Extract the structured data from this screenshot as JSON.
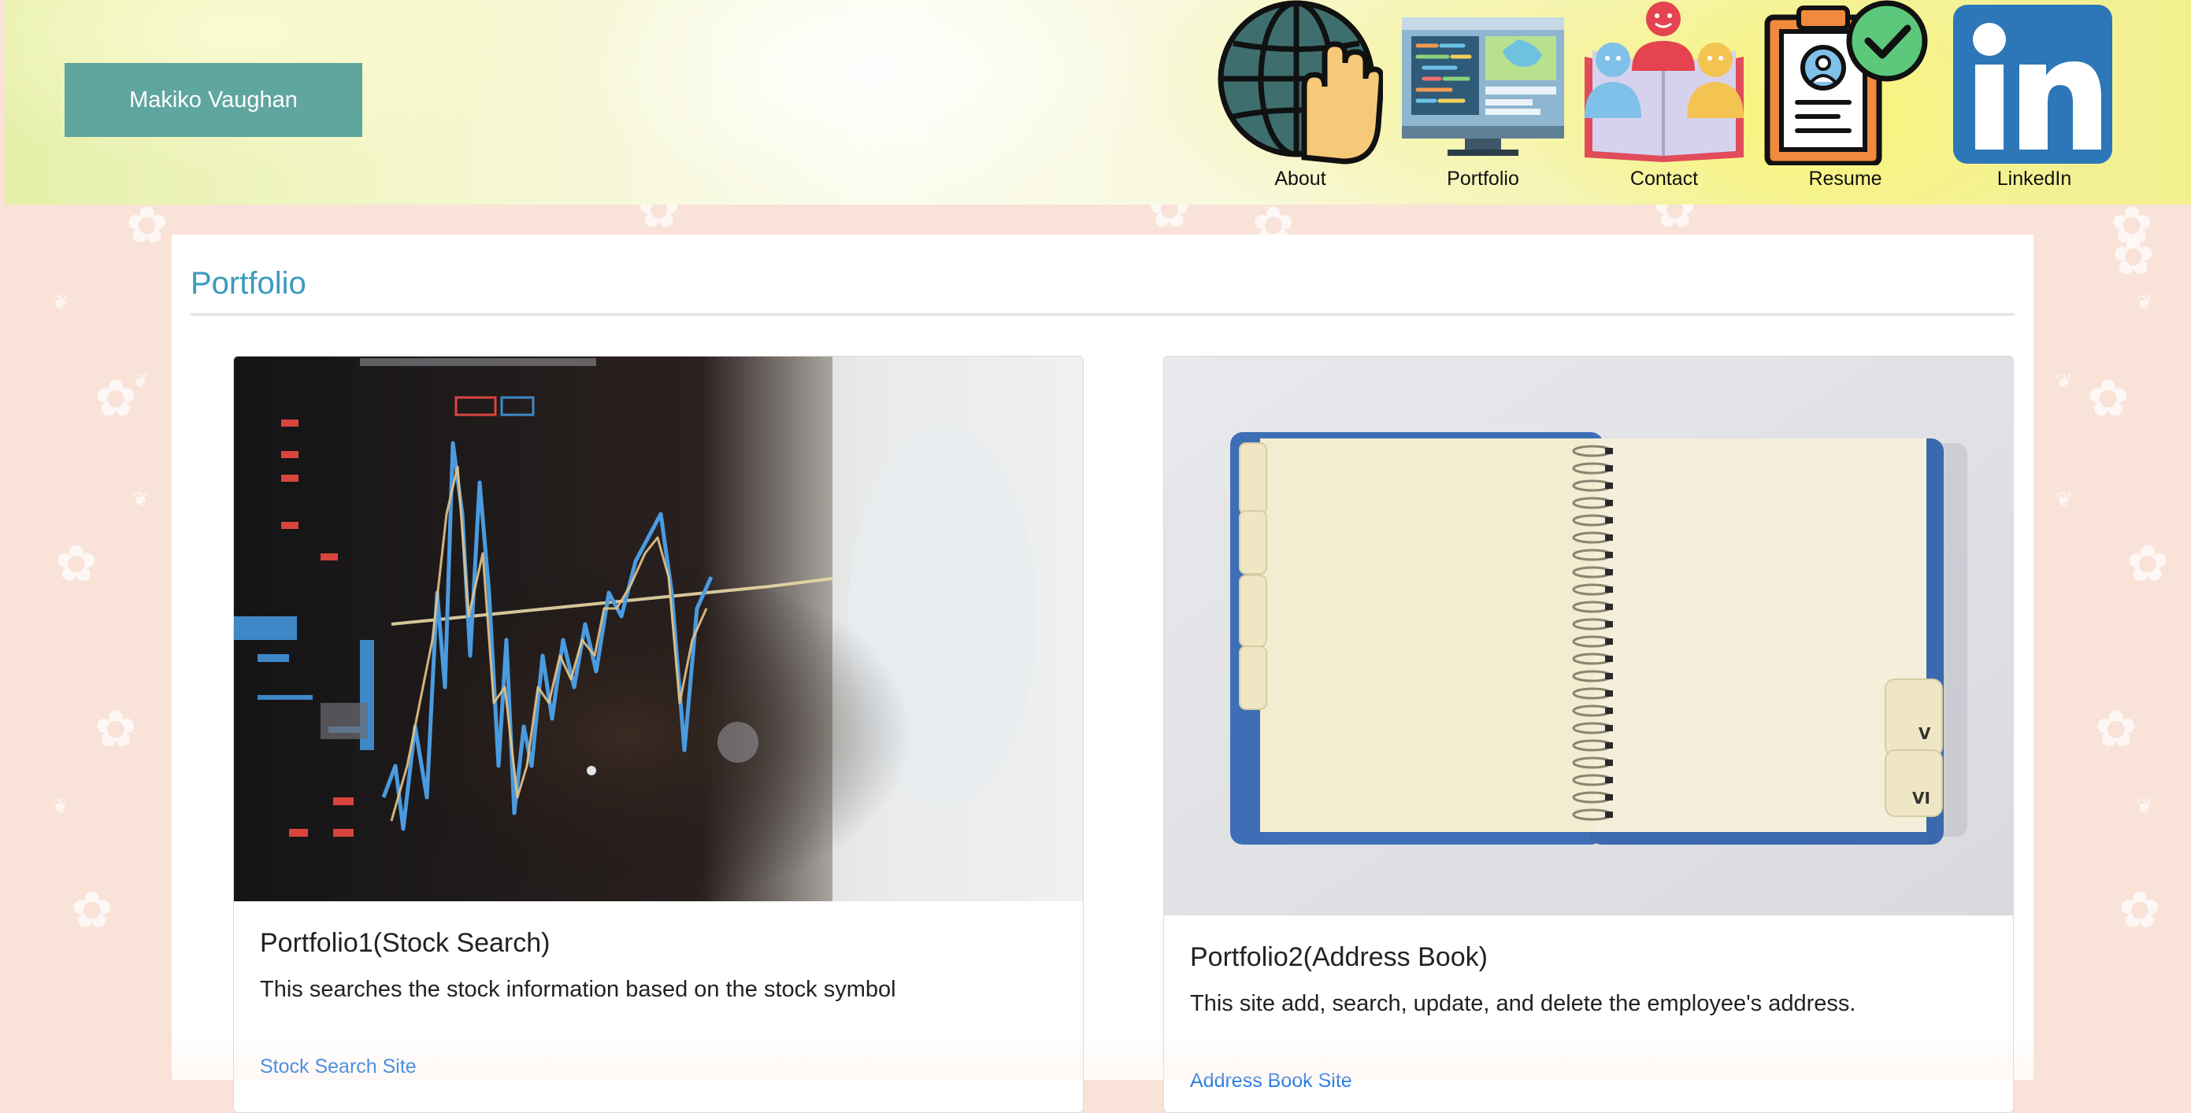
{
  "header": {
    "brand": "Makiko Vaughan",
    "nav": [
      {
        "label": "About",
        "icon": "globe-hand-icon"
      },
      {
        "label": "Portfolio",
        "icon": "monitor-code-icon"
      },
      {
        "label": "Contact",
        "icon": "people-book-icon"
      },
      {
        "label": "Resume",
        "icon": "clipboard-check-icon"
      },
      {
        "label": "LinkedIn",
        "icon": "linkedin-icon"
      }
    ]
  },
  "main": {
    "section_title": "Portfolio",
    "cards": [
      {
        "title": "Portfolio1(Stock Search)",
        "description": "This searches the stock information based on the stock symbol",
        "link": "Stock Search Site",
        "image": "stock-chart-photo"
      },
      {
        "title": "Portfolio2(Address Book)",
        "description": "This site add, search, update, and delete the employee's address.",
        "link": "Address Book Site",
        "image": "notebook-photo",
        "tab_labels": [
          "V",
          "VI"
        ]
      }
    ]
  },
  "colors": {
    "brand_button": "#5fa6a0",
    "section_title": "#3b9bbd",
    "link": "#2a7de1",
    "page_background": "#f9e2d8",
    "linkedin": "#2d77b8"
  }
}
